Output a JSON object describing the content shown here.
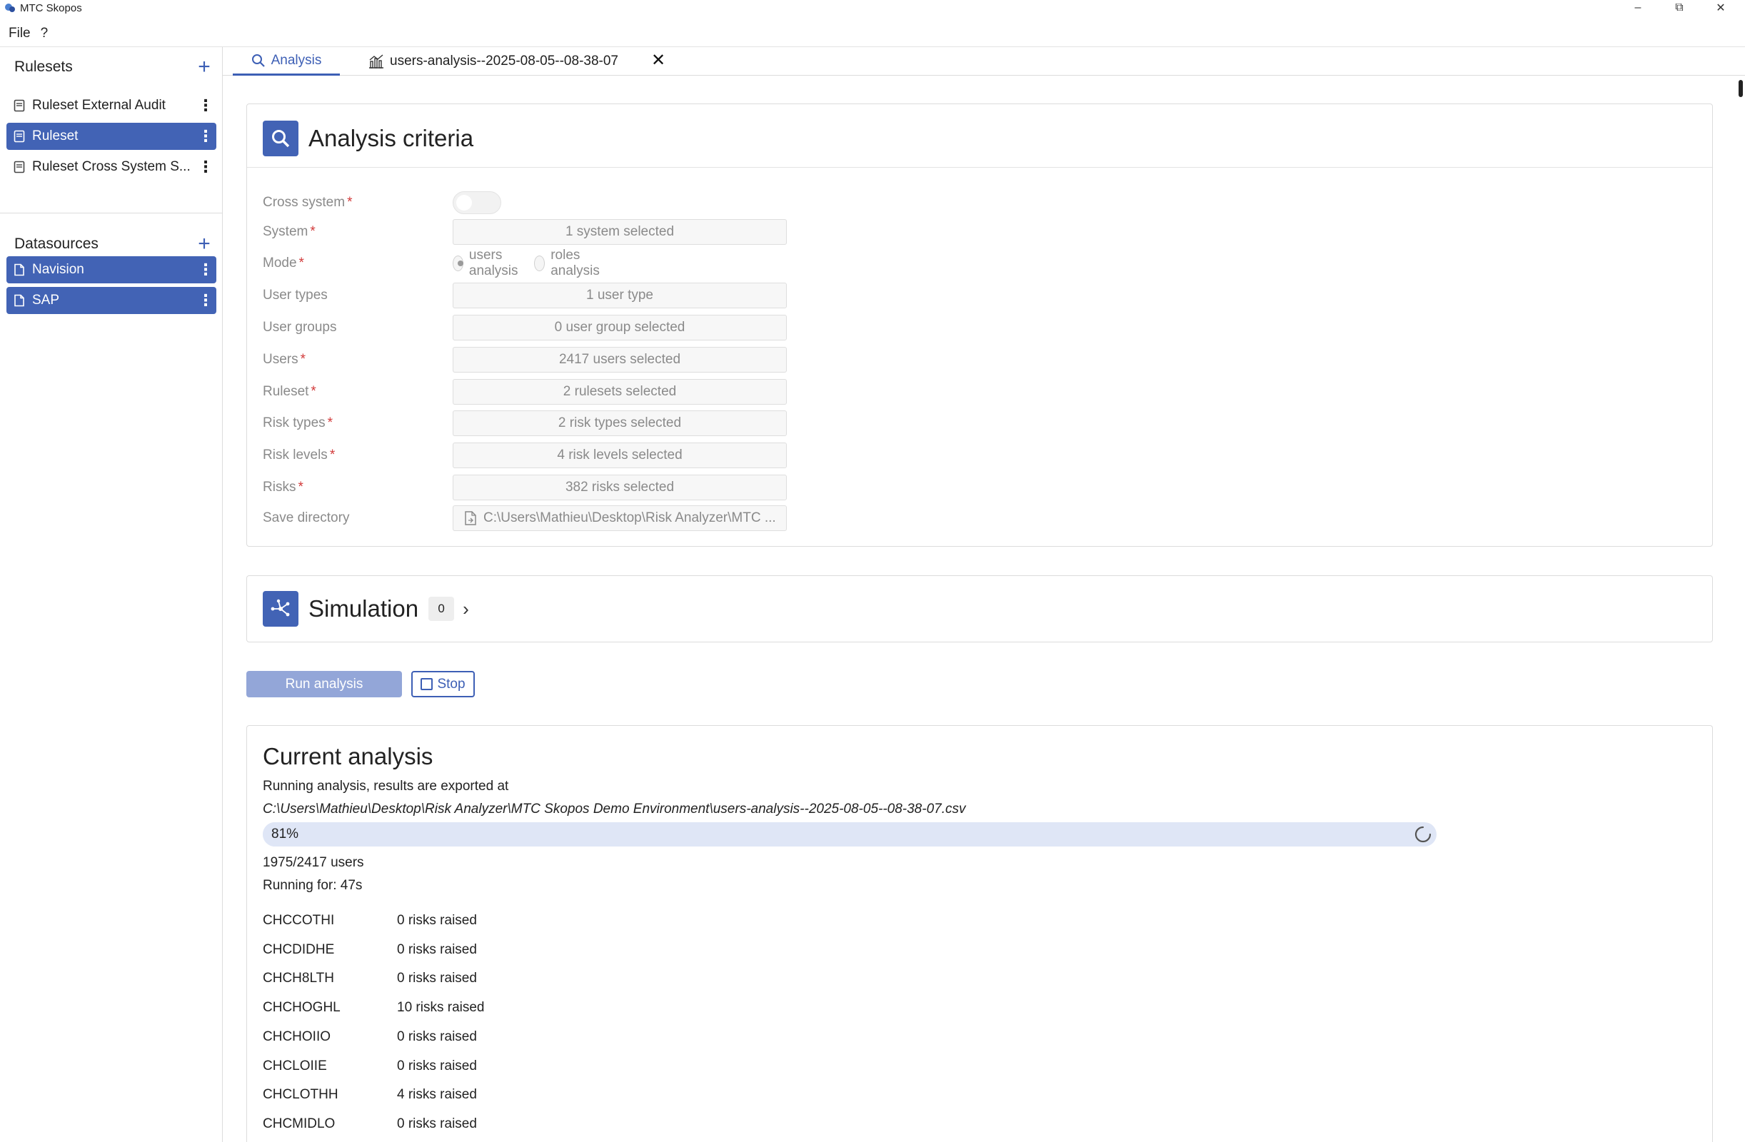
{
  "window": {
    "title": "MTC Skopos"
  },
  "menu": {
    "file": "File",
    "help": "?"
  },
  "sidebar": {
    "rulesets_title": "Rulesets",
    "rulesets": [
      {
        "label": "Ruleset External Audit"
      },
      {
        "label": "Ruleset"
      },
      {
        "label": "Ruleset Cross System S..."
      }
    ],
    "datasources_title": "Datasources",
    "datasources": [
      {
        "label": "Navision"
      },
      {
        "label": "SAP"
      }
    ]
  },
  "tabs": [
    {
      "label": "Analysis"
    },
    {
      "label": "users-analysis--2025-08-05--08-38-07"
    }
  ],
  "criteria": {
    "title": "Analysis criteria",
    "fields": {
      "cross_system": {
        "label": "Cross system"
      },
      "system": {
        "label": "System",
        "value": "1 system selected"
      },
      "mode": {
        "label": "Mode",
        "option_users": "users analysis",
        "option_roles": "roles analysis"
      },
      "user_types": {
        "label": "User types",
        "value": "1 user type"
      },
      "user_groups": {
        "label": "User groups",
        "value": "0 user group selected"
      },
      "users": {
        "label": "Users",
        "value": "2417 users selected"
      },
      "ruleset": {
        "label": "Ruleset",
        "value": "2 rulesets selected"
      },
      "risk_types": {
        "label": "Risk types",
        "value": "2 risk types selected"
      },
      "risk_levels": {
        "label": "Risk levels",
        "value": "4 risk levels selected"
      },
      "risks": {
        "label": "Risks",
        "value": "382 risks selected"
      },
      "save_directory": {
        "label": "Save directory",
        "value": "C:\\Users\\Mathieu\\Desktop\\Risk Analyzer\\MTC ..."
      }
    }
  },
  "simulation": {
    "title": "Simulation",
    "count": "0"
  },
  "actions": {
    "run": "Run analysis",
    "stop": "Stop"
  },
  "current": {
    "title": "Current analysis",
    "running_text": "Running analysis, results are exported at",
    "path": "C:\\Users\\Mathieu\\Desktop\\Risk Analyzer\\MTC Skopos Demo Environment\\users-analysis--2025-08-05--08-38-07.csv",
    "progress_label": "81%",
    "progress_fraction": 0.81,
    "users_progress": "1975/2417 users",
    "running_for": "Running for: 47s",
    "results": [
      {
        "user": "CHCCOTHI",
        "risks": "0 risks raised"
      },
      {
        "user": "CHCDIDHE",
        "risks": "0 risks raised"
      },
      {
        "user": "CHCH8LTH",
        "risks": "0 risks raised"
      },
      {
        "user": "CHCHOGHL",
        "risks": "10 risks raised"
      },
      {
        "user": "CHCHOIIO",
        "risks": "0 risks raised"
      },
      {
        "user": "CHCLOIIE",
        "risks": "0 risks raised"
      },
      {
        "user": "CHCLOTHH",
        "risks": "4 risks raised"
      },
      {
        "user": "CHCMIDLO",
        "risks": "0 risks raised"
      }
    ]
  },
  "colors": {
    "accent": "#4263b5",
    "run_disabled": "#93a6d8",
    "progress_track": "#dfe6f6",
    "required": "#d23a3a"
  }
}
